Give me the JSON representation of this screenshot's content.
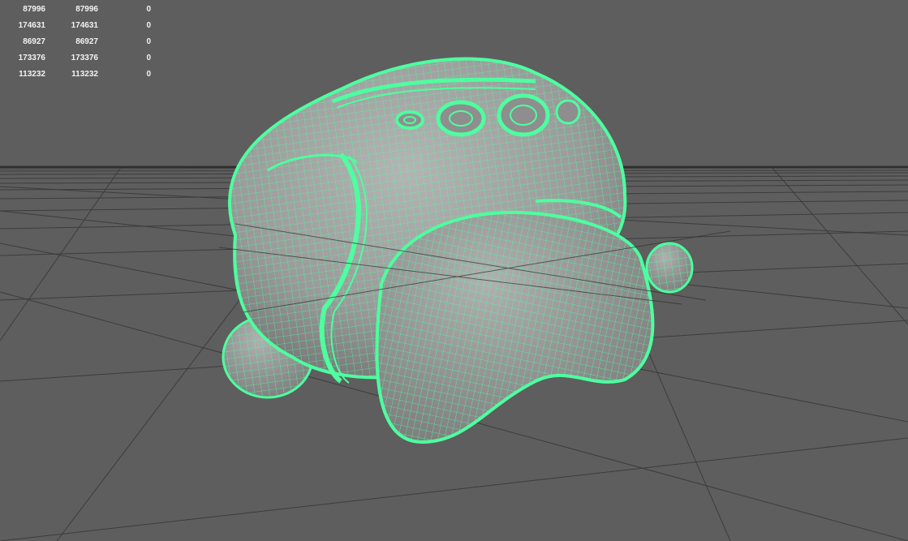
{
  "viewport": {
    "background_color": "#5e5e5e",
    "grid_color": "#3c3c3c",
    "wireframe_color": "#4dff9f",
    "surface_color": "#9a9a9a"
  },
  "hud": {
    "rows": [
      {
        "verts": "87996",
        "edges": "87996",
        "uvs": "0"
      },
      {
        "verts": "174631",
        "edges": "174631",
        "uvs": "0"
      },
      {
        "verts": "86927",
        "edges": "86927",
        "uvs": "0"
      },
      {
        "verts": "173376",
        "edges": "173376",
        "uvs": "0"
      },
      {
        "verts": "113232",
        "edges": "113232",
        "uvs": "0"
      }
    ]
  },
  "model": {
    "icon": "wireframe-mesh-icon"
  }
}
